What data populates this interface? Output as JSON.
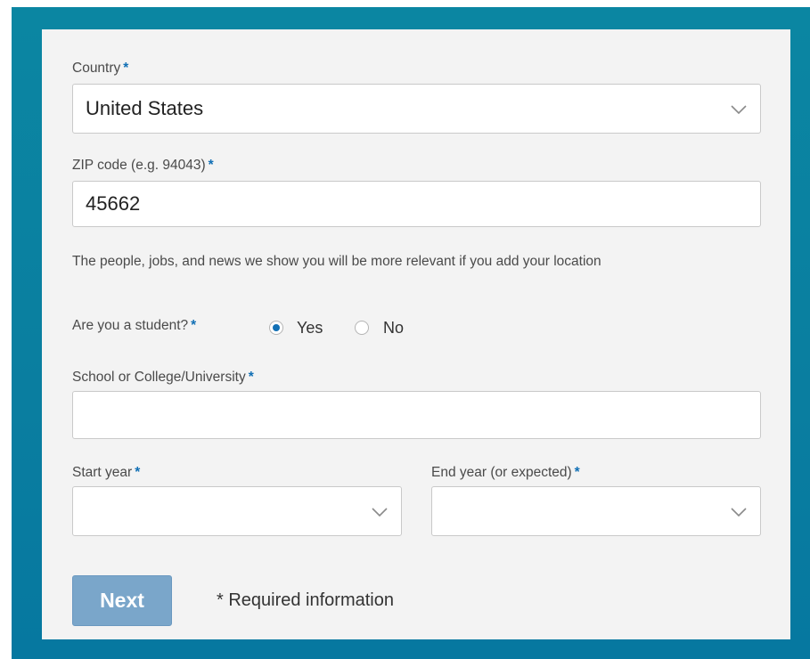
{
  "form": {
    "country": {
      "label": "Country",
      "required_mark": "*",
      "value": "United States",
      "icon": "chevron-down-icon"
    },
    "zip": {
      "label": "ZIP code (e.g. 94043)",
      "required_mark": "*",
      "value": "45662"
    },
    "location_hint": "The people, jobs, and news we show you will be more relevant if you add your location",
    "student": {
      "label": "Are you a student?",
      "required_mark": "*",
      "options": [
        {
          "label": "Yes",
          "checked": true
        },
        {
          "label": "No",
          "checked": false
        }
      ]
    },
    "school": {
      "label": "School or College/University",
      "required_mark": "*",
      "value": ""
    },
    "start_year": {
      "label": "Start year",
      "required_mark": "*",
      "value": "",
      "icon": "chevron-down-icon"
    },
    "end_year": {
      "label": "End year (or expected)",
      "required_mark": "*",
      "value": "",
      "icon": "chevron-down-icon"
    },
    "next_label": "Next",
    "required_note": "* Required information"
  },
  "colors": {
    "accent": "#1270b5",
    "background": "#0b86a2",
    "card": "#f3f3f3",
    "button": "#7aa6ca"
  }
}
